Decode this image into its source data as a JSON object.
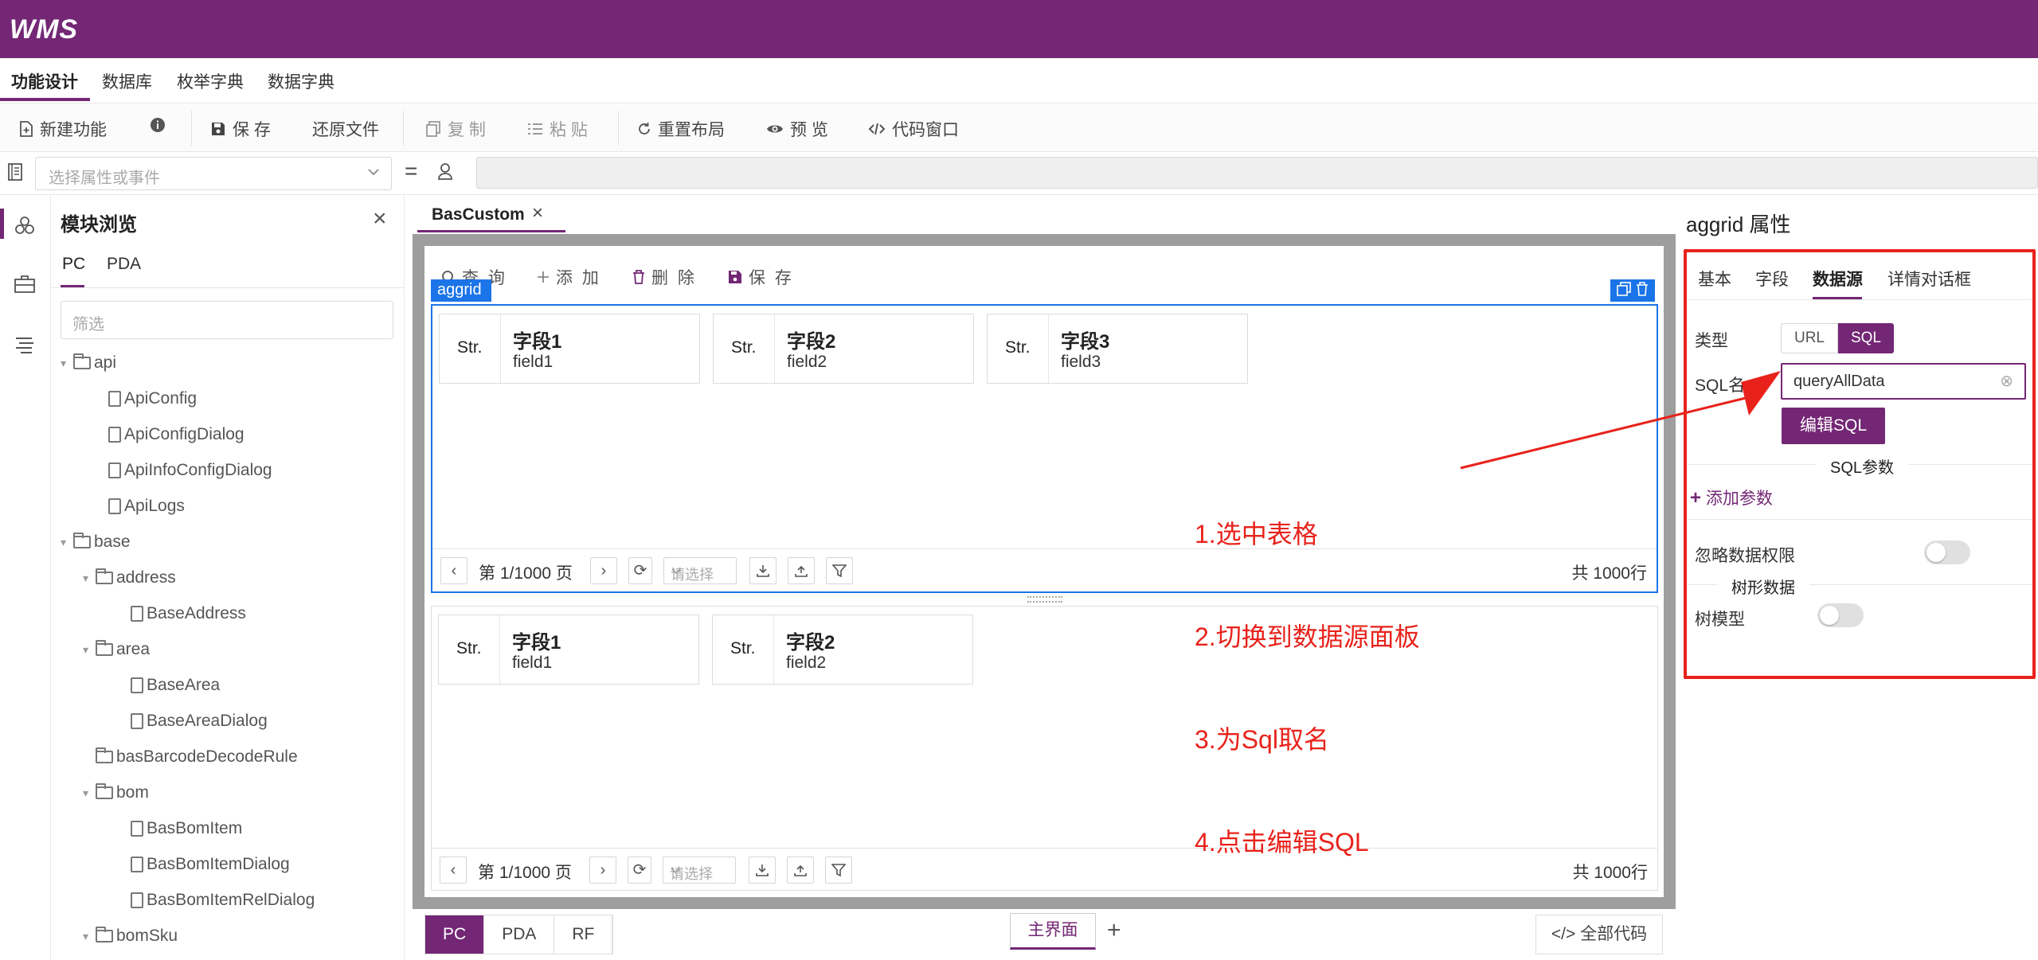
{
  "app": {
    "logo": "WMS",
    "accent": "#732775",
    "highlight": "#1b74e8",
    "annotation_color": "#e8221b"
  },
  "menu": {
    "items": [
      "功能设计",
      "数据库",
      "枚举字典",
      "数据字典"
    ],
    "active": "功能设计"
  },
  "toolbar": {
    "new_function": "新建功能",
    "save": "保 存",
    "restore_file": "还原文件",
    "copy": "复 制",
    "paste": "粘 贴",
    "reset_layout": "重置布局",
    "preview": "预 览",
    "code_window": "代码窗口"
  },
  "attr_select": {
    "placeholder": "选择属性或事件",
    "equals": "="
  },
  "module_browser": {
    "title": "模块浏览",
    "tabs": [
      "PC",
      "PDA"
    ],
    "filter_placeholder": "筛选",
    "tree": [
      {
        "label": "api",
        "type": "folder",
        "depth": 0,
        "expanded": true
      },
      {
        "label": "ApiConfig",
        "type": "file",
        "depth": 1
      },
      {
        "label": "ApiConfigDialog",
        "type": "file",
        "depth": 1
      },
      {
        "label": "ApiInfoConfigDialog",
        "type": "file",
        "depth": 1
      },
      {
        "label": "ApiLogs",
        "type": "file",
        "depth": 1
      },
      {
        "label": "base",
        "type": "folder",
        "depth": 0,
        "expanded": true
      },
      {
        "label": "address",
        "type": "folder",
        "depth": 1,
        "expanded": true
      },
      {
        "label": "BaseAddress",
        "type": "file",
        "depth": 2
      },
      {
        "label": "area",
        "type": "folder",
        "depth": 1,
        "expanded": true
      },
      {
        "label": "BaseArea",
        "type": "file",
        "depth": 2
      },
      {
        "label": "BaseAreaDialog",
        "type": "file",
        "depth": 2
      },
      {
        "label": "basBarcodeDecodeRule",
        "type": "folder",
        "depth": 1,
        "expanded": false
      },
      {
        "label": "bom",
        "type": "folder",
        "depth": 1,
        "expanded": true
      },
      {
        "label": "BasBomItem",
        "type": "file",
        "depth": 2
      },
      {
        "label": "BasBomItemDialog",
        "type": "file",
        "depth": 2
      },
      {
        "label": "BasBomItemRelDialog",
        "type": "file",
        "depth": 2
      },
      {
        "label": "bomSku",
        "type": "folder",
        "depth": 1,
        "expanded": true
      }
    ]
  },
  "editor": {
    "tab": "BasCustom",
    "grid_buttons": {
      "query": "查 询",
      "add": "添 加",
      "delete": "删 除",
      "save": "保 存"
    },
    "aggrid_tag": "aggrid",
    "grid1_fields": [
      {
        "type": "Str.",
        "name": "字段1",
        "id": "field1"
      },
      {
        "type": "Str.",
        "name": "字段2",
        "id": "field2"
      },
      {
        "type": "Str.",
        "name": "字段3",
        "id": "field3"
      }
    ],
    "grid2_fields": [
      {
        "type": "Str.",
        "name": "字段1",
        "id": "field1"
      },
      {
        "type": "Str.",
        "name": "字段2",
        "id": "field2"
      }
    ],
    "pager": {
      "page_text": "第 1/1000 页",
      "select_placeholder": "请选择",
      "total": "共 1000行"
    },
    "annotation": [
      "1.选中表格",
      "2.切换到数据源面板",
      "3.为Sql取名",
      "4.点击编辑SQL"
    ]
  },
  "bottom": {
    "device_tabs": [
      "PC",
      "PDA",
      "RF"
    ],
    "active_device": "PC",
    "main_tab": "主界面",
    "add": "+",
    "all_code": "全部代码"
  },
  "props": {
    "title": "aggrid 属性",
    "tabs": [
      "基本",
      "字段",
      "数据源",
      "详情对话框"
    ],
    "active_tab": "数据源",
    "type_label": "类型",
    "type_options": [
      "URL",
      "SQL"
    ],
    "type_selected": "SQL",
    "sql_name_label": "SQL名",
    "sql_name_value": "queryAllData",
    "edit_sql": "编辑SQL",
    "sql_params": "SQL参数",
    "add_param": "添加参数",
    "ignore_perm": "忽略数据权限",
    "tree_data": "树形数据",
    "tree_model": "树模型"
  }
}
